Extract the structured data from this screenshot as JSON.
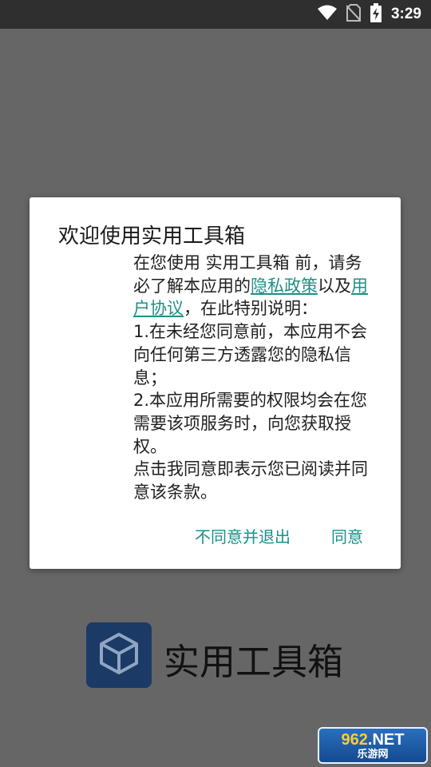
{
  "status_bar": {
    "time": "3:29"
  },
  "dialog": {
    "title": "欢迎使用实用工具箱",
    "para1_prefix": "在您使用 实用工具箱 前，请务必了解本应用的",
    "privacy_link": "隐私政策",
    "para1_mid": "以及",
    "agreement_link": "用户协议",
    "para1_suffix": "，在此特别说明：",
    "para2": "1.在未经您同意前，本应用不会向任何第三方透露您的隐私信息；",
    "para3": "2.本应用所需要的权限均会在您需要该项服务时，向您获取授权。",
    "para4": "点击我同意即表示您已阅读并同意该条款。",
    "disagree_button": "不同意并退出",
    "agree_button": "同意"
  },
  "splash": {
    "app_name": "实用工具箱",
    "logo_icon": "cube-icon"
  },
  "watermark": {
    "top_num": "962",
    "top_rest": ".NET",
    "bottom": "乐游网"
  },
  "colors": {
    "accent": "#14938a",
    "link": "#1f8f86",
    "logo_bg": "#1c3a66"
  }
}
